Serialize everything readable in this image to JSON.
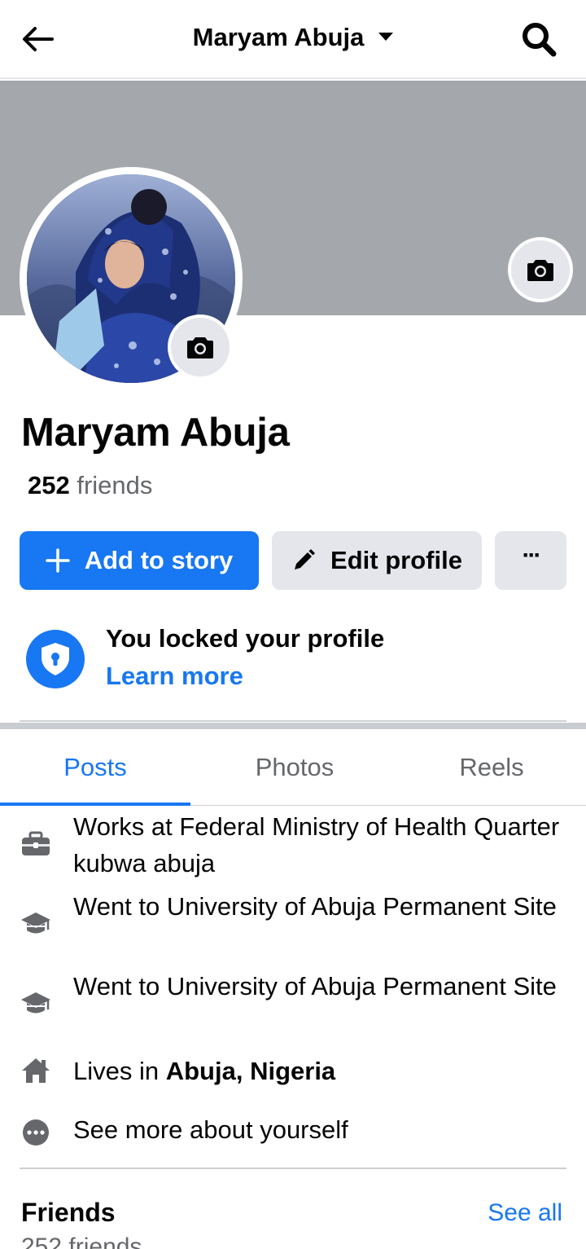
{
  "header": {
    "title": "Maryam Abuja"
  },
  "profile": {
    "name": "Maryam Abuja",
    "friends_number": "252",
    "friends_word": " friends"
  },
  "actions": {
    "add_story_label": "Add to story",
    "edit_profile_label": "Edit profile",
    "more_label": "···"
  },
  "lock_notice": {
    "title": "You locked your profile",
    "link": "Learn more"
  },
  "tabs": [
    {
      "label": "Posts",
      "active": true
    },
    {
      "label": "Photos",
      "active": false
    },
    {
      "label": "Reels",
      "active": false
    }
  ],
  "details": [
    {
      "icon": "briefcase-icon",
      "text": "Works at Federal Ministry of Health Quarter kubwa abuja"
    },
    {
      "icon": "graduation-cap-icon",
      "text": "Went to University of Abuja Permanent Site"
    },
    {
      "icon": "graduation-cap-icon",
      "text": "Went to University of Abuja Permanent Site"
    },
    {
      "icon": "home-icon",
      "text_prefix": "Lives in ",
      "text_bold": "Abuja, Nigeria"
    },
    {
      "icon": "more-dots-icon",
      "text": "See more about yourself"
    }
  ],
  "friends_section": {
    "title": "Friends",
    "see_all": "See all",
    "count": "252 friends"
  },
  "colors": {
    "accent": "#1877f2",
    "cover": "#a4a7ab",
    "secondary_button": "#e4e6eb",
    "muted_text": "#65676b"
  }
}
